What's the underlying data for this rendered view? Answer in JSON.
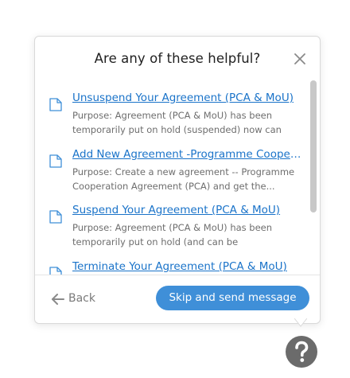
{
  "dialog": {
    "title": "Are any of these helpful?",
    "close_icon": "close-icon"
  },
  "articles": [
    {
      "title": "Unsuspend Your Agreement (PCA & MoU)",
      "description": "Purpose: Agreement (PCA & MoU) has been temporarily put on hold (suspended) now can be..."
    },
    {
      "title": "Add New Agreement -Programme Coopera...",
      "description": "Purpose: Create a new agreement -- Programme Cooperation Agreement (PCA) and get the..."
    },
    {
      "title": "Suspend Your Agreement (PCA & MoU)",
      "description": "Purpose: Agreement (PCA & MoU) has been temporarily put on hold (and can be reactivated..."
    },
    {
      "title": "Terminate Your Agreement (PCA & MoU)",
      "description": ""
    }
  ],
  "footer": {
    "back_label": "Back",
    "skip_label": "Skip and send message"
  },
  "icons": {
    "article": "document-icon",
    "back": "arrow-left-icon",
    "help": "question-mark-icon"
  },
  "colors": {
    "link": "#1a73c9",
    "primary_button": "#3f8fd8",
    "help_fab": "#6b6b6b"
  },
  "scroll": {
    "visible_fraction": 0.67
  }
}
